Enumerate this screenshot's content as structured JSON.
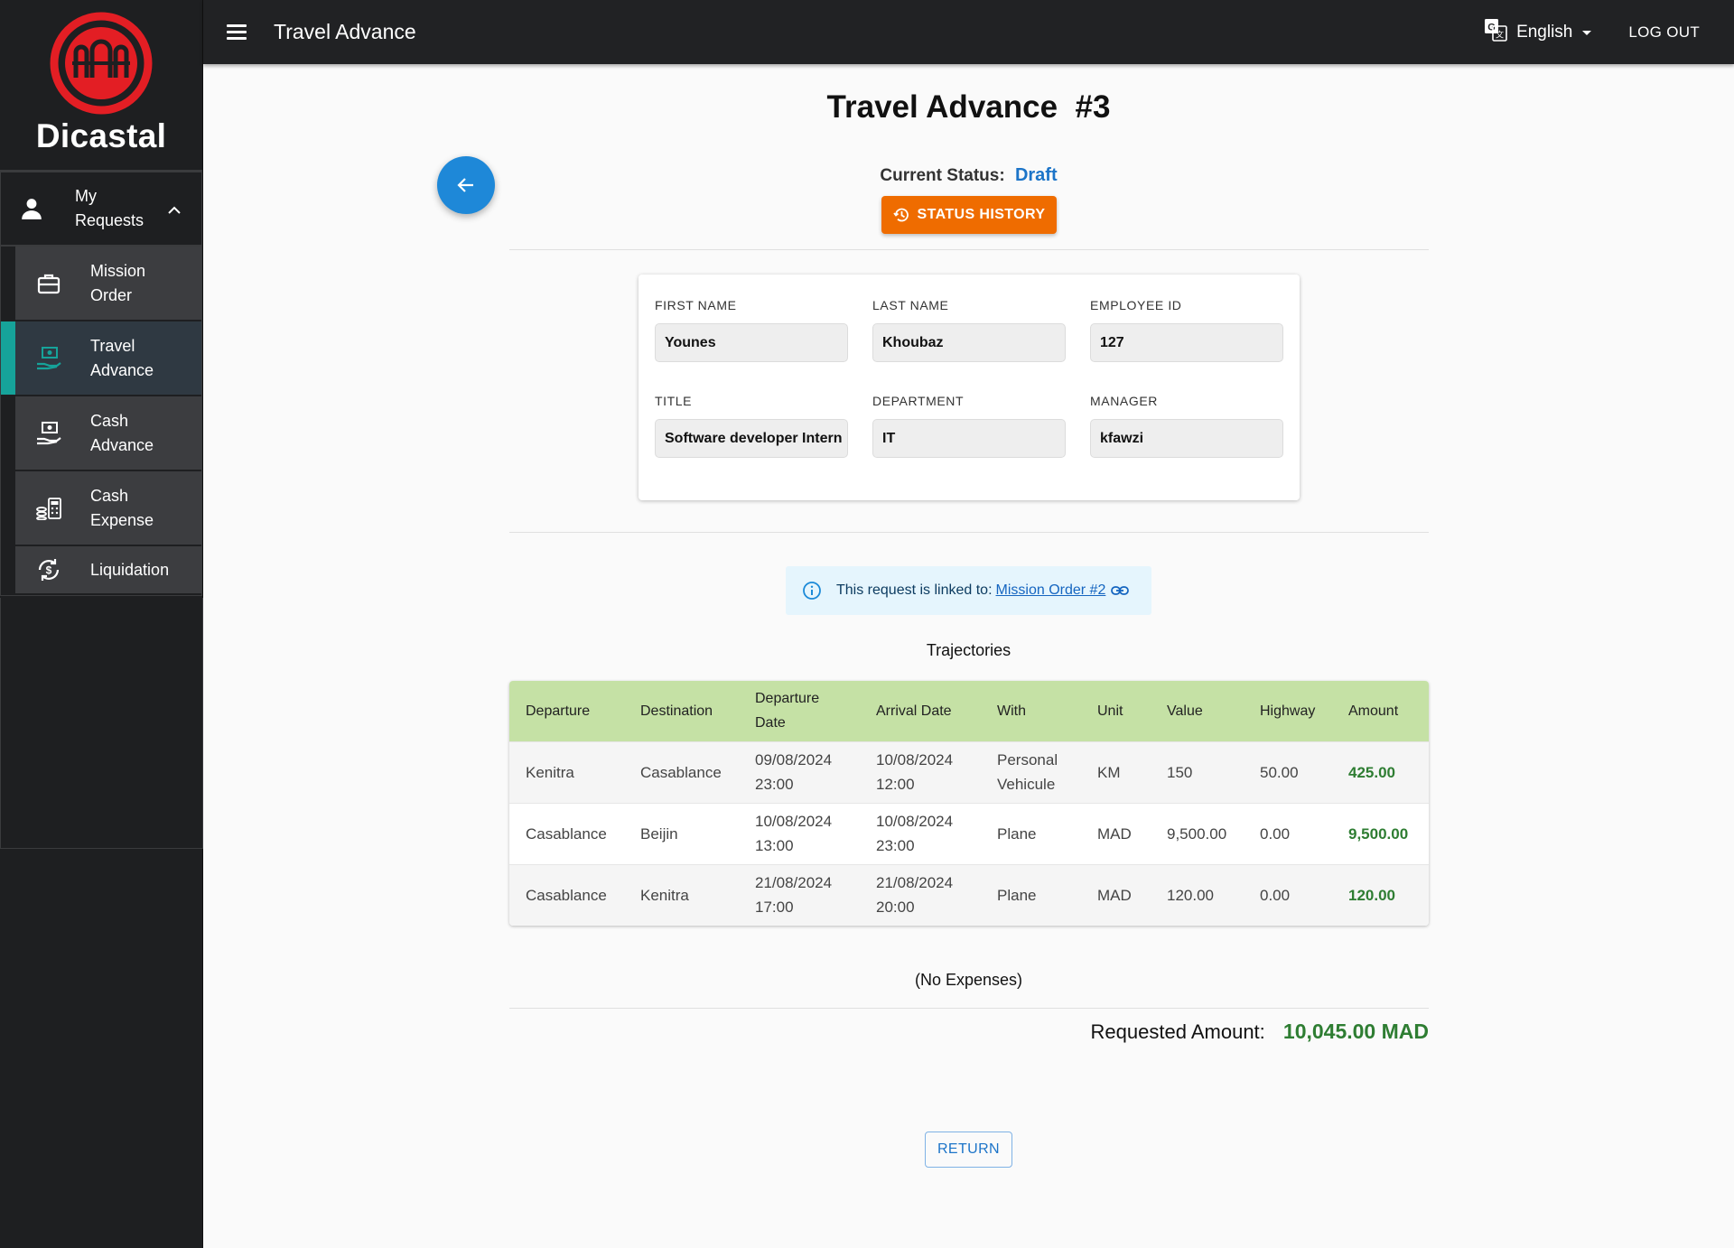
{
  "brand": {
    "name": "Dicastal",
    "logo_color": "#e31e24"
  },
  "topbar": {
    "title": "Travel Advance",
    "language": "English",
    "logout_label": "LOG OUT"
  },
  "sidebar": {
    "parent": {
      "label": "My Requests",
      "icon": "person-icon",
      "expanded": true
    },
    "items": [
      {
        "label": "Mission Order",
        "icon": "briefcase-icon",
        "active": false
      },
      {
        "label": "Travel Advance",
        "icon": "hand-money-icon",
        "active": true
      },
      {
        "label": "Cash Advance",
        "icon": "hand-money-icon",
        "active": false
      },
      {
        "label": "Cash Expense",
        "icon": "coins-calculator-icon",
        "active": false
      },
      {
        "label": "Liquidation",
        "icon": "dollar-cycle-icon",
        "active": false
      }
    ]
  },
  "page": {
    "title": "Travel Advance  #3",
    "status_label": "Current Status:",
    "status_value": "Draft",
    "status_history_label": "STATUS HISTORY"
  },
  "employee": {
    "first_name_label": "FIRST NAME",
    "first_name": "Younes",
    "last_name_label": "LAST NAME",
    "last_name": "Khoubaz",
    "employee_id_label": "EMPLOYEE ID",
    "employee_id": "127",
    "title_label": "TITLE",
    "title": "Software developer Intern",
    "department_label": "DEPARTMENT",
    "department": "IT",
    "manager_label": "MANAGER",
    "manager": "kfawzi"
  },
  "linked": {
    "text": "This request is linked to:",
    "link_label": "Mission Order #2"
  },
  "trajectories": {
    "heading": "Trajectories",
    "columns": [
      "Departure",
      "Destination",
      "Departure Date",
      "Arrival Date",
      "With",
      "Unit",
      "Value",
      "Highway",
      "Amount"
    ],
    "rows": [
      {
        "departure": "Kenitra",
        "destination": "Casablance",
        "departure_date": "09/08/2024 23:00",
        "arrival_date": "10/08/2024 12:00",
        "with": "Personal Vehicule",
        "unit": "KM",
        "value": "150",
        "highway": "50.00",
        "amount": "425.00"
      },
      {
        "departure": "Casablance",
        "destination": "Beijin",
        "departure_date": "10/08/2024 13:00",
        "arrival_date": "10/08/2024 23:00",
        "with": "Plane",
        "unit": "MAD",
        "value": "9,500.00",
        "highway": "0.00",
        "amount": "9,500.00"
      },
      {
        "departure": "Casablance",
        "destination": "Kenitra",
        "departure_date": "21/08/2024 17:00",
        "arrival_date": "21/08/2024 20:00",
        "with": "Plane",
        "unit": "MAD",
        "value": "120.00",
        "highway": "0.00",
        "amount": "120.00"
      }
    ]
  },
  "expenses": {
    "empty_text": "(No Expenses)"
  },
  "totals": {
    "label": "Requested Amount:",
    "value": "10,045.00 MAD"
  },
  "actions": {
    "return_label": "RETURN"
  },
  "colors": {
    "accent_teal": "#16a39a",
    "status_orange": "#ef6c00",
    "primary_blue": "#1e88d8",
    "amount_green": "#2e7d32",
    "table_header": "#c5e1a5"
  }
}
